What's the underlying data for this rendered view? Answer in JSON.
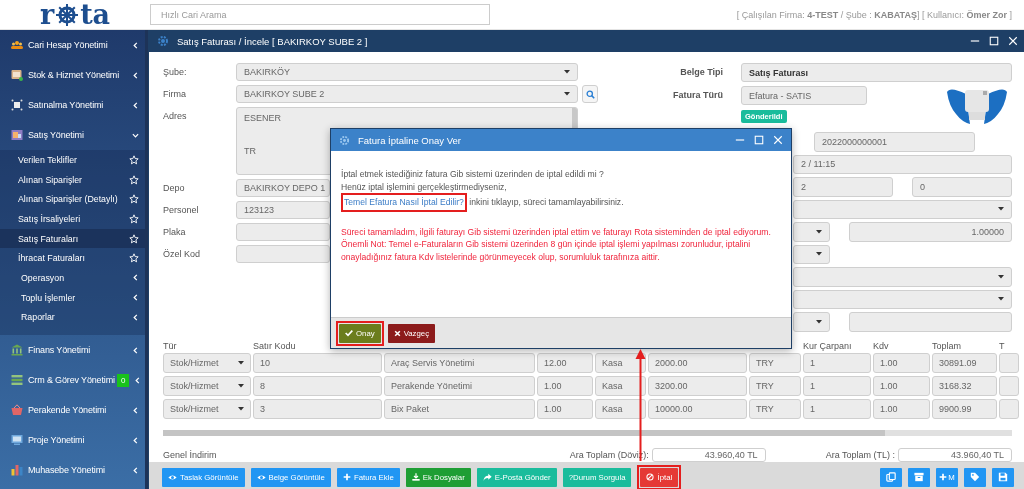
{
  "logo": {
    "lead": "r",
    "tail": "ta"
  },
  "search": {
    "placeholder": "Hızlı Cari Arama"
  },
  "session": "[ Çalışılan Firma: **4-TEST** / Şube : **KABATAŞ**] [ Kullanıcı: **Ömer Zor** ]",
  "sidebar": {
    "items": [
      {
        "label": "Cari Hesap Yönetimi",
        "expanded": false
      },
      {
        "label": "Stok & Hizmet Yönetimi",
        "expanded": false
      },
      {
        "label": "Satınalma Yönetimi",
        "expanded": false
      },
      {
        "label": "Satış Yönetimi",
        "expanded": true,
        "children": [
          {
            "label": "Verilen Teklifler",
            "kind": "page",
            "selected": false
          },
          {
            "label": "Alınan Siparişler",
            "kind": "page",
            "selected": false
          },
          {
            "label": "Alınan Siparişler (Detaylı)",
            "kind": "page",
            "selected": false
          },
          {
            "label": "Satış İrsaliyeleri",
            "kind": "page",
            "selected": false
          },
          {
            "label": "Satış Faturaları",
            "kind": "page",
            "selected": true
          },
          {
            "label": "İhracat Faturaları",
            "kind": "page",
            "selected": false
          },
          {
            "label": "Operasyon",
            "kind": "group",
            "expanded": false
          },
          {
            "label": "Toplu İşlemler",
            "kind": "group",
            "expanded": false
          },
          {
            "label": "Raporlar",
            "kind": "group",
            "expanded": false
          }
        ]
      },
      {
        "label": "Finans Yönetimi",
        "expanded": false
      },
      {
        "label": "Crm & Görev Yönetimi",
        "expanded": false,
        "badge": "0"
      },
      {
        "label": "Perakende Yönetimi",
        "expanded": false
      },
      {
        "label": "Proje Yönetimi",
        "expanded": false
      },
      {
        "label": "Muhasebe Yönetimi",
        "expanded": false
      }
    ]
  },
  "window": {
    "title": "Satış Faturası / İncele [ BAKIRKOY SUBE 2 ]"
  },
  "form": {
    "left": [
      {
        "label": "Şube:",
        "kind": "select",
        "value": "BAKIRKÖY"
      },
      {
        "label": "Firma",
        "kind": "select-search",
        "value": "BAKIRKOY SUBE 2"
      },
      {
        "label": "Adres",
        "kind": "textarea",
        "lines": [
          "ESENER",
          "TR"
        ]
      },
      {
        "label": "Depo",
        "kind": "input",
        "value": "BAKIRKOY DEPO 1"
      },
      {
        "label": "Personel",
        "kind": "input",
        "value": "123123"
      },
      {
        "label": "Plaka",
        "kind": "input"
      },
      {
        "label": "Özel Kod",
        "kind": "input"
      }
    ],
    "right": [
      {
        "label": "Belge Tipi",
        "kind": "strong",
        "value": "Satış Faturası"
      },
      {
        "label": "Fatura Türü",
        "kind": "input",
        "value": "Efatura - SATIS",
        "badge": "Gönderildi"
      }
    ],
    "right_rows": [
      [
        {
          "kind": "input-short",
          "value": "2022000000001"
        }
      ],
      [
        {
          "kind": "input",
          "value": "2 / 11:15"
        }
      ],
      [
        {
          "kind": "input",
          "value": "2"
        },
        {
          "kind": "input",
          "value": "0"
        }
      ],
      [
        {
          "kind": "select"
        }
      ],
      [
        {
          "kind": "select-short"
        },
        {
          "kind": "number",
          "value": "1.00000"
        }
      ],
      [
        {
          "kind": "select-short"
        }
      ],
      [
        {
          "kind": "select"
        }
      ],
      [
        {
          "kind": "select"
        }
      ],
      [
        {
          "kind": "select-short"
        },
        {
          "kind": "input"
        }
      ]
    ]
  },
  "table": {
    "columns": [
      {
        "label": "Tür"
      },
      {
        "label": "Satır Kodu"
      },
      {},
      {},
      {},
      {},
      {},
      {
        "label": "Kur Çarpanı"
      },
      {
        "label": "Kdv"
      },
      {
        "label": "Toplam"
      },
      {
        "label": "T"
      }
    ],
    "rows": [
      [
        {
          "kind": "select",
          "value": "Stok/Hizmet"
        },
        {
          "kind": "input",
          "value": "10"
        },
        {
          "kind": "input",
          "value": "Araç Servis Yönetimi"
        },
        {
          "kind": "input",
          "value": "12.00"
        },
        {
          "kind": "input",
          "value": "Kasa"
        },
        {
          "kind": "input",
          "value": "2000.00"
        },
        {
          "kind": "input",
          "value": "TRY"
        },
        {
          "kind": "input",
          "value": "1"
        },
        {
          "kind": "input",
          "value": "1.00"
        },
        {
          "kind": "input",
          "value": "30891.09"
        },
        {
          "kind": "input"
        }
      ],
      [
        {
          "kind": "select",
          "value": "Stok/Hizmet"
        },
        {
          "kind": "input",
          "value": "8"
        },
        {
          "kind": "input",
          "value": "Perakende Yönetimi"
        },
        {
          "kind": "input",
          "value": "1.00"
        },
        {
          "kind": "input",
          "value": "Kasa"
        },
        {
          "kind": "input",
          "value": "3200.00"
        },
        {
          "kind": "input",
          "value": "TRY"
        },
        {
          "kind": "input",
          "value": "1"
        },
        {
          "kind": "input",
          "value": "1.00"
        },
        {
          "kind": "input",
          "value": "3168.32"
        },
        {
          "kind": "input"
        }
      ],
      [
        {
          "kind": "select",
          "value": "Stok/Hizmet"
        },
        {
          "kind": "input",
          "value": "3"
        },
        {
          "kind": "input",
          "value": "Bix Paket"
        },
        {
          "kind": "input",
          "value": "1.00"
        },
        {
          "kind": "input",
          "value": "Kasa"
        },
        {
          "kind": "input",
          "value": "10000.00"
        },
        {
          "kind": "input",
          "value": "TRY"
        },
        {
          "kind": "input",
          "value": "1"
        },
        {
          "kind": "input",
          "value": "1.00"
        },
        {
          "kind": "input",
          "value": "9900.99"
        },
        {
          "kind": "input"
        }
      ]
    ]
  },
  "totals": {
    "discount_label": "Genel İndirim",
    "subtotals": [
      {
        "label": "Ara Toplam (Döviz):",
        "value": "43.960,40 TL"
      },
      {
        "label": "Ara Toplam (TL) :",
        "value": "43.960,40 TL"
      }
    ]
  },
  "toolbar": {
    "buttons": [
      {
        "label": "Taslak Görüntüle",
        "kind": "view",
        "highlighted": false
      },
      {
        "label": "Belge Görüntüle",
        "kind": "view",
        "highlighted": false
      },
      {
        "label": "Fatura Ekle",
        "kind": "add",
        "highlighted": false
      },
      {
        "label": "Ek Dosyalar",
        "kind": "attach",
        "highlighted": false
      },
      {
        "label": "E-Posta Gönder",
        "kind": "send",
        "highlighted": false
      },
      {
        "label": "Durum Sorgula",
        "kind": "query",
        "glyph": "?",
        "highlighted": false
      },
      {
        "label": "İptal",
        "kind": "cancel",
        "highlighted": true
      }
    ],
    "icon_buttons": [
      {
        "kind": "copy"
      },
      {
        "kind": "archive"
      },
      {
        "kind": "add",
        "label": "M"
      },
      {
        "kind": "tag"
      },
      {
        "kind": "save"
      }
    ]
  },
  "modal": {
    "title": "Fatura İptaline Onay Ver",
    "question": "İptal etmek istediğiniz fatura Gib sistemi üzerinden de iptal edildi mi ?",
    "hint": "Henüz iptal işlemini gerçekleştirmediyseniz,",
    "link": {
      "text": "Temel Efatura Nasıl İptal Edilir?",
      "highlighted": true
    },
    "link_tail": "inkini tıklayıp, süreci tamamlayabilirsiniz.",
    "warnings": [
      "Süreci tamamladım, ilgili faturayı Gib sistemi üzerinden iptal ettim ve faturayı Rota sisteminden de iptal ediyorum.",
      "Önemli Not: Temel e-Faturaların Gib sistemi üzerinden 8 gün içinde iptal işlemi yapılması zorunludur, iptalini onayladığınız fatura Kdv listelerinde görünmeyecek olup, sorumluluk tarafınıza aittir."
    ],
    "buttons": [
      {
        "label": "Onay",
        "kind": "confirm",
        "highlighted": true
      },
      {
        "label": "Vazgeç",
        "kind": "dismiss",
        "highlighted": false
      }
    ]
  }
}
